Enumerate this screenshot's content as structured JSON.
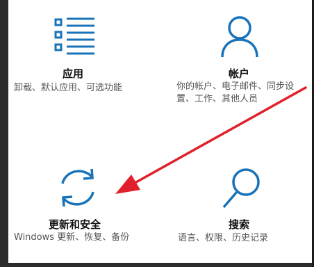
{
  "settings": {
    "tiles": [
      {
        "title": "应用",
        "description": "卸载、默认应用、可选功能",
        "icon": "apps-list-icon"
      },
      {
        "title": "帐户",
        "description": "你的帐户、电子邮件、同步设置、工作、其他人员",
        "icon": "person-icon"
      },
      {
        "title": "更新和安全",
        "description": "Windows 更新、恢复、备份",
        "icon": "sync-icon"
      },
      {
        "title": "搜索",
        "description": "语言、权限、历史记录",
        "icon": "search-icon"
      }
    ]
  },
  "colors": {
    "accent": "#1a73b8",
    "annotation_arrow": "#e0202a"
  },
  "annotation": {
    "icon": "red-arrow-pointing-to-update-and-security"
  }
}
